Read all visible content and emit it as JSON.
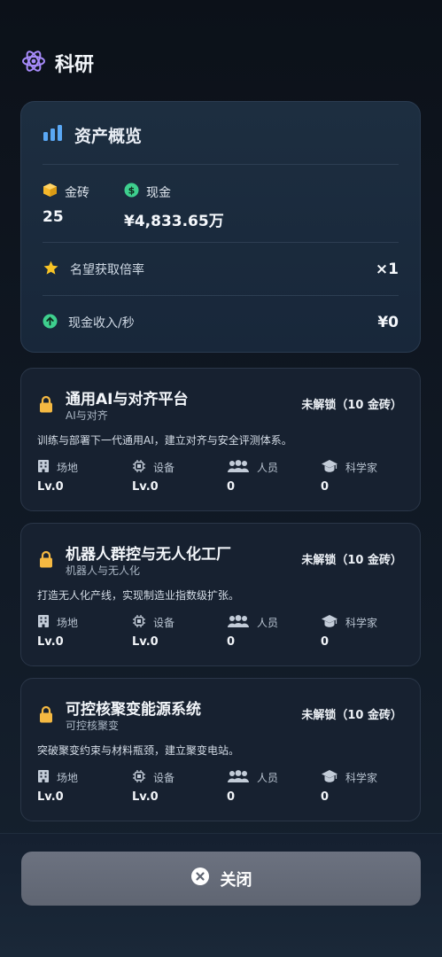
{
  "header": {
    "title": "科研",
    "icon": "atom-icon",
    "icon_color": "#a78bfa"
  },
  "overview": {
    "title": "资产概览",
    "gold": {
      "label": "金砖",
      "value": "25"
    },
    "cash": {
      "label": "现金",
      "value": "¥4,833.65万"
    },
    "reputation": {
      "label": "名望获取倍率",
      "value": "×1"
    },
    "income": {
      "label": "现金收入/秒",
      "value": "¥0"
    }
  },
  "stat_labels": {
    "site": "场地",
    "equipment": "设备",
    "staff": "人员",
    "scientist": "科学家"
  },
  "projects": [
    {
      "name": "通用AI与对齐平台",
      "subtitle": "AI与对齐",
      "status": "未解锁（10 金砖）",
      "description": "训练与部署下一代通用AI，建立对齐与安全评测体系。",
      "site": "Lv.0",
      "equipment": "Lv.0",
      "staff": "0",
      "scientist": "0"
    },
    {
      "name": "机器人群控与无人化工厂",
      "subtitle": "机器人与无人化",
      "status": "未解锁（10 金砖）",
      "description": "打造无人化产线，实现制造业指数级扩张。",
      "site": "Lv.0",
      "equipment": "Lv.0",
      "staff": "0",
      "scientist": "0"
    },
    {
      "name": "可控核聚变能源系统",
      "subtitle": "可控核聚变",
      "status": "未解锁（10 金砖）",
      "description": "突破聚变约束与材料瓶颈，建立聚变电站。",
      "site": "Lv.0",
      "equipment": "Lv.0",
      "staff": "0",
      "scientist": "0"
    }
  ],
  "footer": {
    "close_label": "关闭"
  },
  "colors": {
    "lock": "#f5b942",
    "gold": "#f5b72a",
    "cash": "#3ecf8e",
    "star": "#f7c325",
    "chart": "#5aa8f5"
  }
}
